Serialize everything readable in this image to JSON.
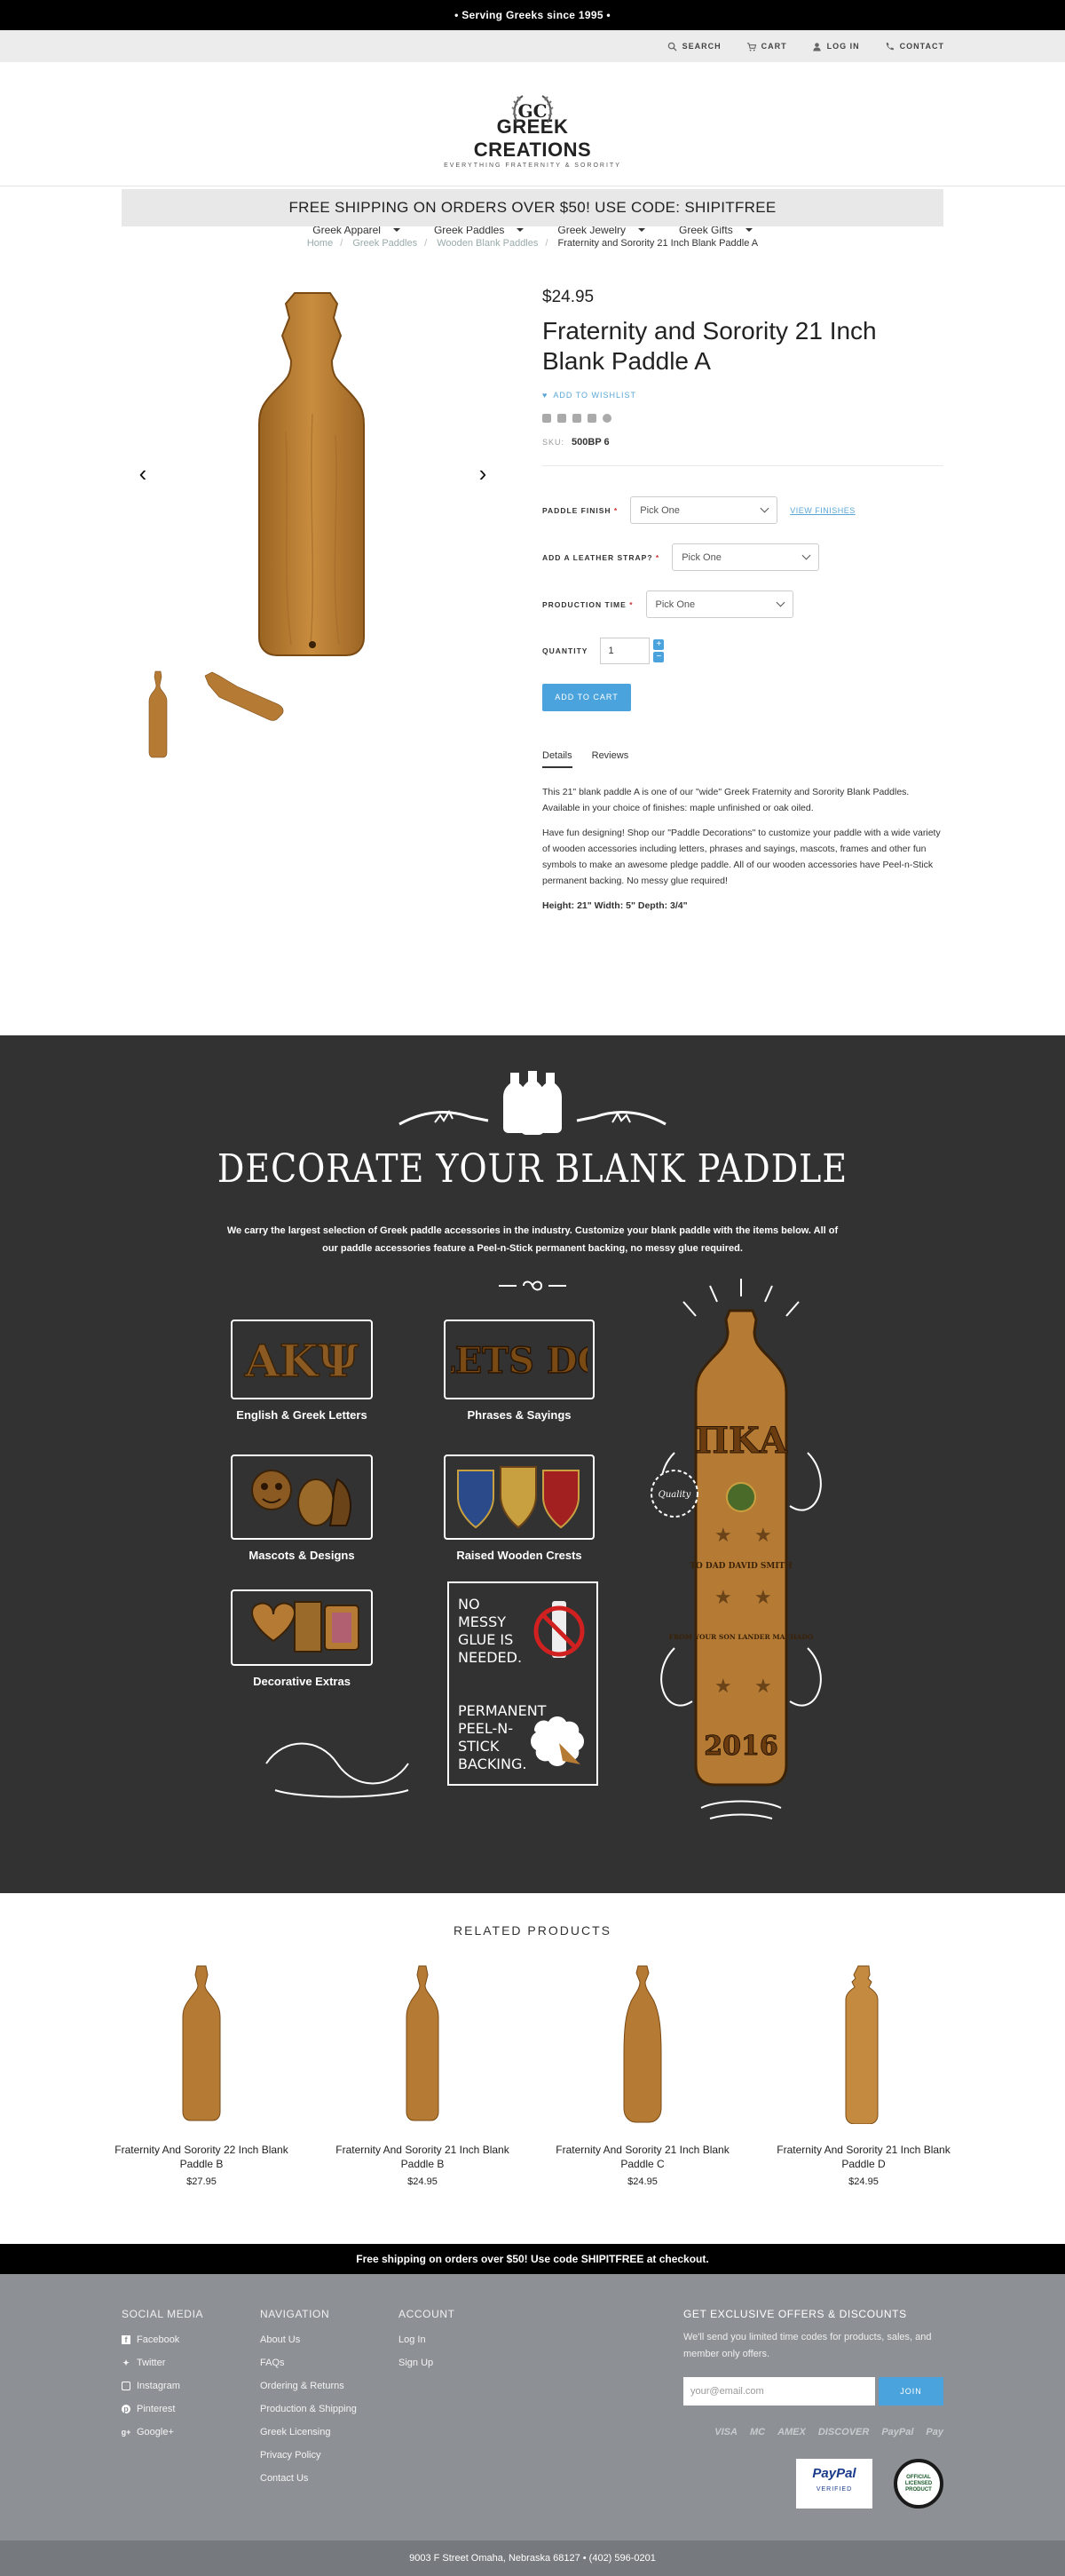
{
  "topbar": {
    "text": "• Serving Greeks since 1995 •"
  },
  "utility": {
    "search": "SEARCH",
    "cart": "CART",
    "login": "LOG IN",
    "contact": "CONTACT"
  },
  "logo": {
    "name": "GREEK CREATIONS",
    "tagline": "EVERYTHING FRATERNITY & SORORITY",
    "mark": "GC"
  },
  "nav": {
    "items": [
      "Greek Apparel",
      "Greek Paddles",
      "Greek Jewelry",
      "Greek Gifts"
    ]
  },
  "promo": {
    "text": "FREE SHIPPING ON ORDERS OVER $50! USE CODE: SHIPITFREE"
  },
  "breadcrumb": [
    "Home",
    "Greek Paddles",
    "Wooden Blank Paddles",
    "Fraternity and Sorority 21 Inch Blank Paddle A"
  ],
  "product": {
    "price": "$24.95",
    "title": "Fraternity and Sorority 21 Inch Blank Paddle A",
    "wishlist": "ADD TO WISHLIST",
    "sku_label": "SKU:",
    "sku": "500BP 6",
    "options": [
      {
        "label": "PADDLE FINISH",
        "value": "Pick One",
        "link": "VIEW FINISHES"
      },
      {
        "label": "ADD A LEATHER STRAP?",
        "value": "Pick One"
      },
      {
        "label": "PRODUCTION TIME",
        "value": "Pick One"
      }
    ],
    "quantity_label": "QUANTITY",
    "quantity": "1",
    "add_to_cart": "ADD TO CART",
    "tabs": [
      "Details",
      "Reviews"
    ],
    "description": [
      "This 21\" blank paddle A is one of our \"wide\" Greek Fraternity and Sorority Blank Paddles. Available in your choice of finishes: maple unfinished or oak oiled.",
      "Have fun designing! Shop our \"Paddle Decorations\" to customize your paddle with a wide variety of wooden accessories including letters, phrases and sayings, mascots, frames and other fun symbols to make an awesome pledge paddle. All of our wooden accessories have Peel-n-Stick permanent backing. No messy glue required!"
    ],
    "dimensions": "Height: 21\" Width: 5\" Depth: 3/4\""
  },
  "decorate": {
    "title": "DECORATE YOUR BLANK PADDLE",
    "text": "We carry the largest selection of Greek paddle accessories in the industry. Customize your blank paddle with the items below. All of our paddle accessories feature a Peel-n-Stick permanent backing, no messy glue required.",
    "items": [
      "English & Greek Letters",
      "Phrases & Sayings",
      "Mascots & Designs",
      "Raised Wooden Crests",
      "Decorative Extras"
    ],
    "glue_text": "NO MESSY GLUE IS NEEDED.",
    "peel_text": "PERMANENT PEEL-N-STICK BACKING.",
    "letters_sample": "ΑΚΨ",
    "phrases_sample": "LETS DO",
    "crest_badge": "Quality",
    "paddle_letters": "ΠΚΑ",
    "paddle_to": "TO DAD DAVID SMITH",
    "paddle_from": "FROM YOUR SON LANDER MACHADO",
    "paddle_year": "2016"
  },
  "related": {
    "title": "RELATED PRODUCTS",
    "products": [
      {
        "name": "Fraternity And Sorority 22 Inch Blank Paddle B",
        "price": "$27.95"
      },
      {
        "name": "Fraternity And Sorority 21 Inch Blank Paddle B",
        "price": "$24.95"
      },
      {
        "name": "Fraternity And Sorority 21 Inch Blank Paddle C",
        "price": "$24.95"
      },
      {
        "name": "Fraternity And Sorority 21 Inch Blank Paddle D",
        "price": "$24.95"
      }
    ]
  },
  "shipbar": {
    "text": "Free shipping on orders over $50! Use code SHIPITFREE at checkout."
  },
  "footer": {
    "social": {
      "title": "SOCIAL MEDIA",
      "items": [
        "Facebook",
        "Twitter",
        "Instagram",
        "Pinterest",
        "Google+"
      ]
    },
    "navigation": {
      "title": "NAVIGATION",
      "items": [
        "About Us",
        "FAQs",
        "Ordering & Returns",
        "Production & Shipping",
        "Greek Licensing",
        "Privacy Policy",
        "Contact Us"
      ]
    },
    "account": {
      "title": "ACCOUNT",
      "items": [
        "Log In",
        "Sign Up"
      ]
    },
    "offers": {
      "title": "GET EXCLUSIVE OFFERS & DISCOUNTS",
      "text": "We'll send you limited time codes for products, sales, and member only offers.",
      "placeholder": "your@email.com",
      "join": "JOIN"
    },
    "payments": [
      "VISA",
      "MC",
      "AMEX",
      "DISCOVER",
      "PayPal",
      "Pay"
    ],
    "badge_paypal": "PayPal",
    "badge_paypal_sub": "VERIFIED",
    "badge_licensed": "OFFICIAL LICENSED PRODUCT",
    "address": "9003 F Street Omaha, Nebraska 68127 • (402) 596-0201"
  }
}
